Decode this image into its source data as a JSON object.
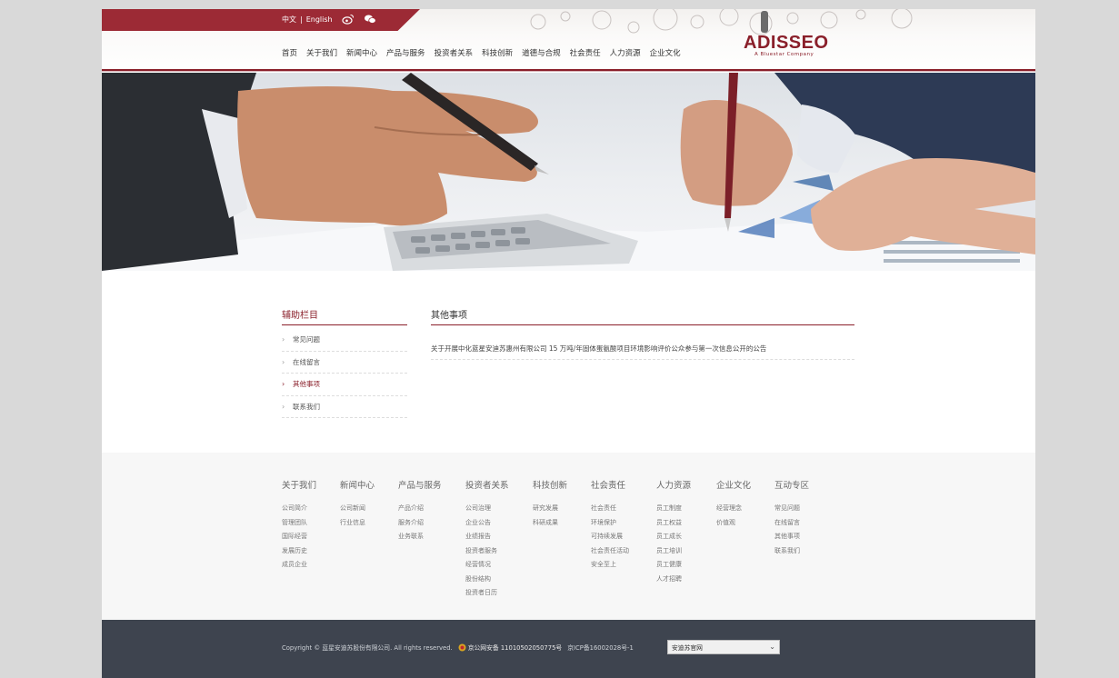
{
  "header": {
    "lang_zh": "中文",
    "lang_sep": "|",
    "lang_en": "English",
    "logo_text": "ADISSEO",
    "logo_sub": "A Bluestar Company",
    "nav": [
      "首页",
      "关于我们",
      "新闻中心",
      "产品与服务",
      "投资者关系",
      "科技创新",
      "道德与合规",
      "社会责任",
      "人力资源",
      "企业文化"
    ]
  },
  "sidebar": {
    "title": "辅助栏目",
    "items": [
      {
        "label": "常见问题"
      },
      {
        "label": "在线留言"
      },
      {
        "label": "其他事项",
        "active": true
      },
      {
        "label": "联系我们"
      }
    ]
  },
  "main": {
    "title": "其他事项",
    "articles": [
      "关于开展中化蓝星安迪苏惠州有限公司 15 万吨/年固体蛋氨酸项目环境影响评价公众参与第一次信息公开的公告"
    ]
  },
  "footer": {
    "columns": [
      {
        "head": "关于我们",
        "items": [
          "公司简介",
          "管理团队",
          "国际经营",
          "发展历史",
          "成员企业"
        ]
      },
      {
        "head": "新闻中心",
        "items": [
          "公司新闻",
          "行业信息"
        ]
      },
      {
        "head": "产品与服务",
        "items": [
          "产品介绍",
          "服务介绍",
          "业务联系"
        ]
      },
      {
        "head": "投资者关系",
        "items": [
          "公司治理",
          "企业公告",
          "业绩报告",
          "投资者服务",
          "经营情况",
          "股份结构",
          "投资者日历"
        ]
      },
      {
        "head": "科技创新",
        "items": [
          "研究发展",
          "科研成果"
        ]
      },
      {
        "head": "社会责任",
        "items": [
          "社会责任",
          "环境保护",
          "可持续发展",
          "社会责任活动",
          "安全至上"
        ]
      },
      {
        "head": "人力资源",
        "items": [
          "员工制度",
          "员工权益",
          "员工成长",
          "员工培训",
          "员工健康",
          "人才招聘"
        ]
      },
      {
        "head": "企业文化",
        "items": [
          "经营理念",
          "价值观"
        ]
      },
      {
        "head": "互动专区",
        "items": [
          "常见问题",
          "在线留言",
          "其他事项",
          "联系我们"
        ]
      }
    ],
    "copyright": "Copyright © 蓝星安迪苏股份有限公司. All rights reserved.",
    "beian": "京公网安备 11010502050775号",
    "icp": "京ICP备16002028号-1",
    "select_value": "安迪苏官网"
  },
  "colors": {
    "brand": "#8a1f2a",
    "topbar": "#9c2a35",
    "bottom_bar": "#3e444f"
  }
}
